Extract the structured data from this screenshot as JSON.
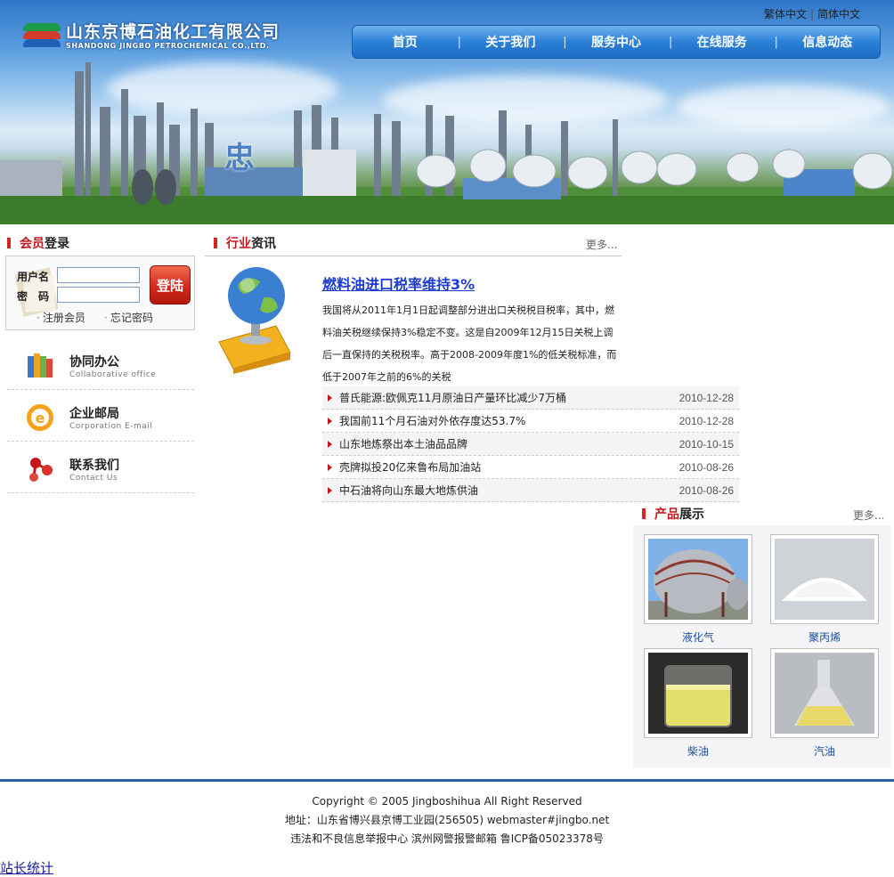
{
  "header": {
    "logo_cn": "山东京博石油化工有限公司",
    "logo_en": "SHANDONG JINGBO PETROCHEMICAL CO.,LTD.",
    "lang_traditional": "繁体中文",
    "lang_separator": "|",
    "lang_simplified": "简体中文",
    "banner_char": "忠"
  },
  "nav": {
    "items": [
      "首页",
      "关于我们",
      "服务中心",
      "在线服务",
      "信息动态"
    ],
    "divider": "|"
  },
  "login": {
    "heading_highlight": "会员",
    "heading_rest": "登录",
    "username_label": "用户名",
    "password_label": "密　码",
    "username_value": "",
    "password_value": "",
    "submit_label": "登陆",
    "register_link": "注册会员",
    "forgot_link": "忘记密码"
  },
  "sidebar": {
    "items": [
      {
        "title": "协同办公",
        "subtitle": "Collaborative office",
        "icon": "books-icon"
      },
      {
        "title": "企业邮局",
        "subtitle": "Corporation E-mail",
        "icon": "email-icon"
      },
      {
        "title": "联系我们",
        "subtitle": "Contact Us",
        "icon": "contact-icon"
      }
    ]
  },
  "news": {
    "heading_highlight": "行业",
    "heading_rest": "资讯",
    "more": "更多...",
    "featured_title": "燃料油进口税率维持3%",
    "featured_summary": "我国将从2011年1月1日起调整部分进出口关税税目税率，其中，燃料油关税继续保持3%稳定不变。这是自2009年12月15日关税上调后一直保持的关税税率。高于2008-2009年度1%的低关税标准，而低于2007年之前的6%的关税",
    "list": [
      {
        "title": "普氏能源:欧佩克11月原油日产量环比减少7万桶",
        "date": "2010-12-28"
      },
      {
        "title": "我国前11个月石油对外依存度达53.7%",
        "date": "2010-12-28"
      },
      {
        "title": "山东地炼祭出本土油品品牌",
        "date": "2010-10-15"
      },
      {
        "title": "壳牌拟投20亿来鲁布局加油站",
        "date": "2010-08-26"
      },
      {
        "title": "中石油将向山东最大地炼供油",
        "date": "2010-08-26"
      }
    ]
  },
  "products": {
    "heading_highlight": "产品",
    "heading_rest": "展示",
    "more": "更多...",
    "items": [
      {
        "name": "液化气"
      },
      {
        "name": "聚丙烯"
      },
      {
        "name": "柴油"
      },
      {
        "name": "汽油"
      }
    ]
  },
  "footer": {
    "copyright": "Copyright © 2005 Jingboshihua All Right Reserved",
    "address": "地址：山东省博兴县京博工业园(256505) webmaster#jingbo.net",
    "report": "违法和不良信息举报中心 滨州网警报警邮箱 鲁ICP备05023378号"
  },
  "stats_link": "站长统计",
  "colors": {
    "accent_red": "#c4161c",
    "nav_blue": "#2d82d8",
    "link_blue": "#1d3bd0",
    "footer_rule": "#2a5ea6"
  }
}
